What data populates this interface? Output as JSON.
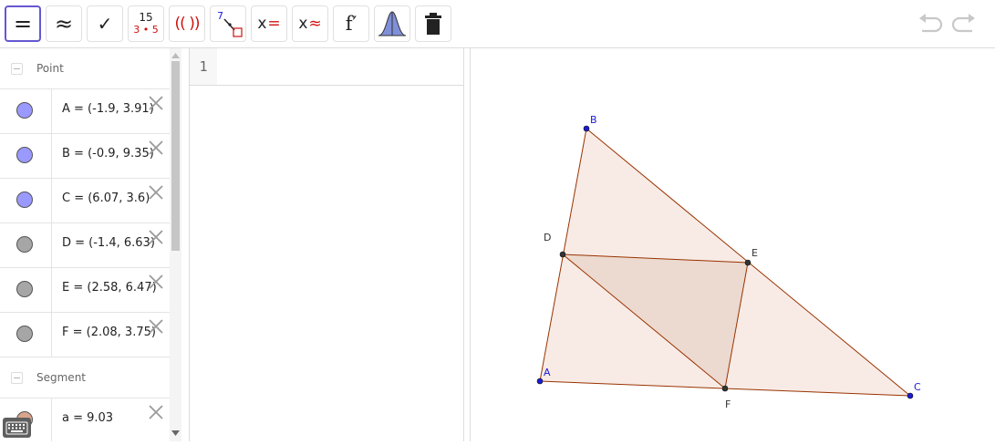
{
  "toolbar": {
    "tools": [
      {
        "name": "evaluate-tool",
        "label": "="
      },
      {
        "name": "numeric-tool",
        "label": "≈"
      },
      {
        "name": "keep-input-tool",
        "label": "✓"
      },
      {
        "name": "factor-tool",
        "label_top": "15",
        "label_bottom": "3 • 5"
      },
      {
        "name": "expand-tool",
        "label": "(( ))"
      },
      {
        "name": "substitute-tool",
        "label": "7"
      },
      {
        "name": "solve-tool",
        "label_x": "x",
        "label_sym": "="
      },
      {
        "name": "solve-numerically-tool",
        "label_x": "x",
        "label_sym": "≈"
      },
      {
        "name": "derivative-tool",
        "label": "f′"
      },
      {
        "name": "probability-tool",
        "label": ""
      },
      {
        "name": "delete-tool",
        "label": ""
      }
    ],
    "accent_color": "#6557d2"
  },
  "algebra": {
    "categories": [
      {
        "label": "Point"
      },
      {
        "label": "Segment"
      }
    ],
    "points": [
      {
        "expr": "A = (-1.9, 3.91)",
        "color": "#9999ff"
      },
      {
        "expr": "B = (-0.9, 9.35)",
        "color": "#9999ff"
      },
      {
        "expr": "C = (6.07, 3.6)",
        "color": "#9999ff"
      },
      {
        "expr": "D = (-1.4, 6.63)",
        "color": "#a6a6a6"
      },
      {
        "expr": "E = (2.58, 6.47)",
        "color": "#a6a6a6"
      },
      {
        "expr": "F = (2.08, 3.75)",
        "color": "#a6a6a6"
      }
    ],
    "segments": [
      {
        "expr": "a = 9.03",
        "color": "#d9a58c"
      }
    ]
  },
  "cas": {
    "row_number": "1"
  },
  "graphics": {
    "labels": {
      "A": "A",
      "B": "B",
      "C": "C",
      "D": "D",
      "E": "E",
      "F": "F"
    },
    "colors": {
      "free_point": "#1a1ad6",
      "dependent_point": "#333333",
      "polygon_fill": "#f5e4dd",
      "inner_fill": "#ecd9cf",
      "segment": "#993300"
    }
  }
}
